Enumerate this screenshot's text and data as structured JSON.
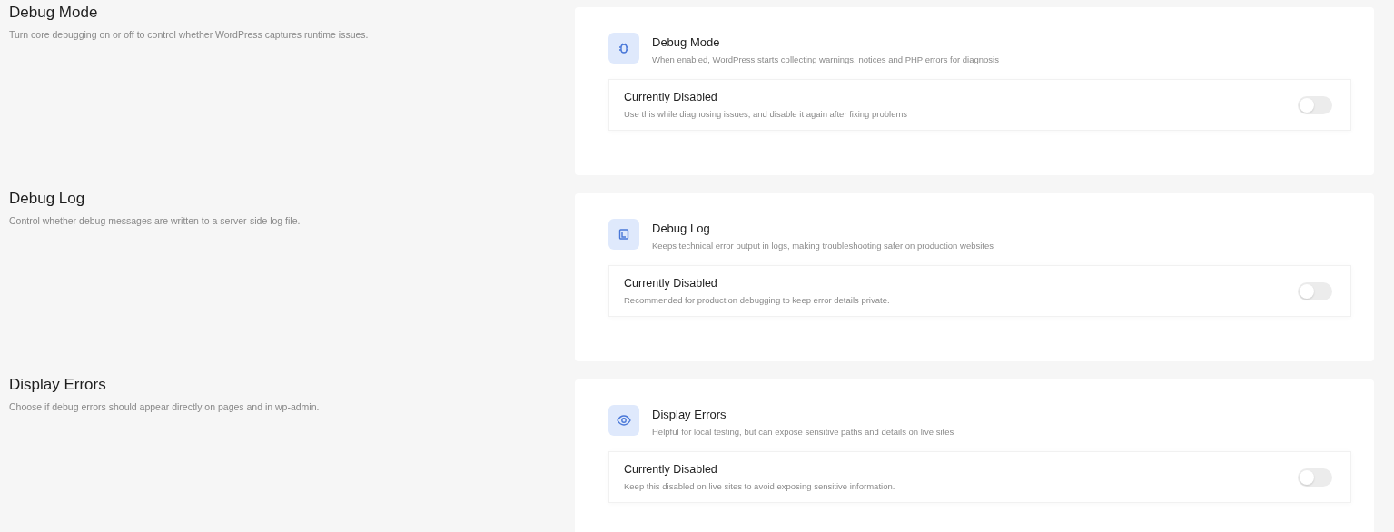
{
  "sections": [
    {
      "title": "Debug Mode",
      "description": "Turn core debugging on or off to control whether WordPress captures runtime issues.",
      "card": {
        "title": "Debug Mode",
        "description": "When enabled, WordPress starts collecting warnings, notices and PHP errors for diagnosis",
        "status": "Currently Disabled",
        "hint": "Use this while diagnosing issues, and disable it again after fixing problems",
        "on": false
      }
    },
    {
      "title": "Debug Log",
      "description": "Control whether debug messages are written to a server-side log file.",
      "card": {
        "title": "Debug Log",
        "description": "Keeps technical error output in logs, making troubleshooting safer on production websites",
        "status": "Currently Disabled",
        "hint": "Recommended for production debugging to keep error details private.",
        "on": false
      }
    },
    {
      "title": "Display Errors",
      "description": "Choose if debug errors should appear directly on pages and in wp-admin.",
      "card": {
        "title": "Display Errors",
        "description": "Helpful for local testing, but can expose sensitive paths and details on live sites",
        "status": "Currently Disabled",
        "hint": "Keep this disabled on live sites to avoid exposing sensitive information.",
        "on": false
      }
    }
  ]
}
